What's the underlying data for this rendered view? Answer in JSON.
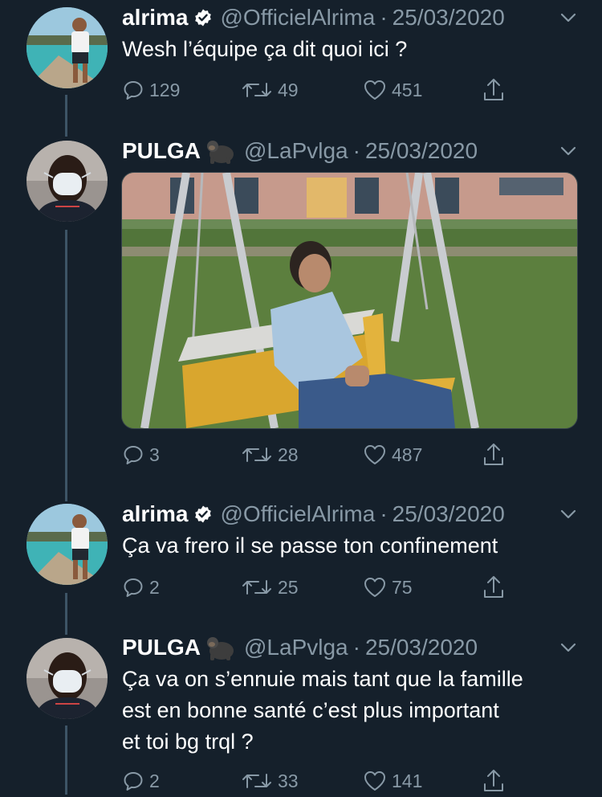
{
  "tweets": [
    {
      "name": "alrima",
      "handle": "@OfficielAlrima",
      "separator": "·",
      "date": "25/03/2020",
      "text": "Wesh l’équipe ça dit quoi ici ?",
      "replies": "129",
      "retweets": "49",
      "likes": "451",
      "verified": true
    },
    {
      "name": "PULGA",
      "handle": "@LaPvlga",
      "separator": "·",
      "date": "25/03/2020",
      "text": "",
      "replies": "3",
      "retweets": "28",
      "likes": "487",
      "emoji": "gorilla-icon"
    },
    {
      "name": "alrima",
      "handle": "@OfficielAlrima",
      "separator": "·",
      "date": "25/03/2020",
      "text": "Ça va frero il se passe ton confinement",
      "replies": "2",
      "retweets": "25",
      "likes": "75",
      "verified": true
    },
    {
      "name": "PULGA",
      "handle": "@LaPvlga",
      "separator": "·",
      "date": "25/03/2020",
      "text_lines": [
        "Ça va on s’ennuie mais tant que la famille",
        "est en bonne santé c’est plus important",
        "et toi bg trql ?"
      ],
      "replies": "2",
      "retweets": "33",
      "likes": "141",
      "emoji": "gorilla-icon"
    }
  ],
  "colors": {
    "background": "#15202b",
    "secondary_text": "#8899a6",
    "thread_line": "#3d5466"
  }
}
